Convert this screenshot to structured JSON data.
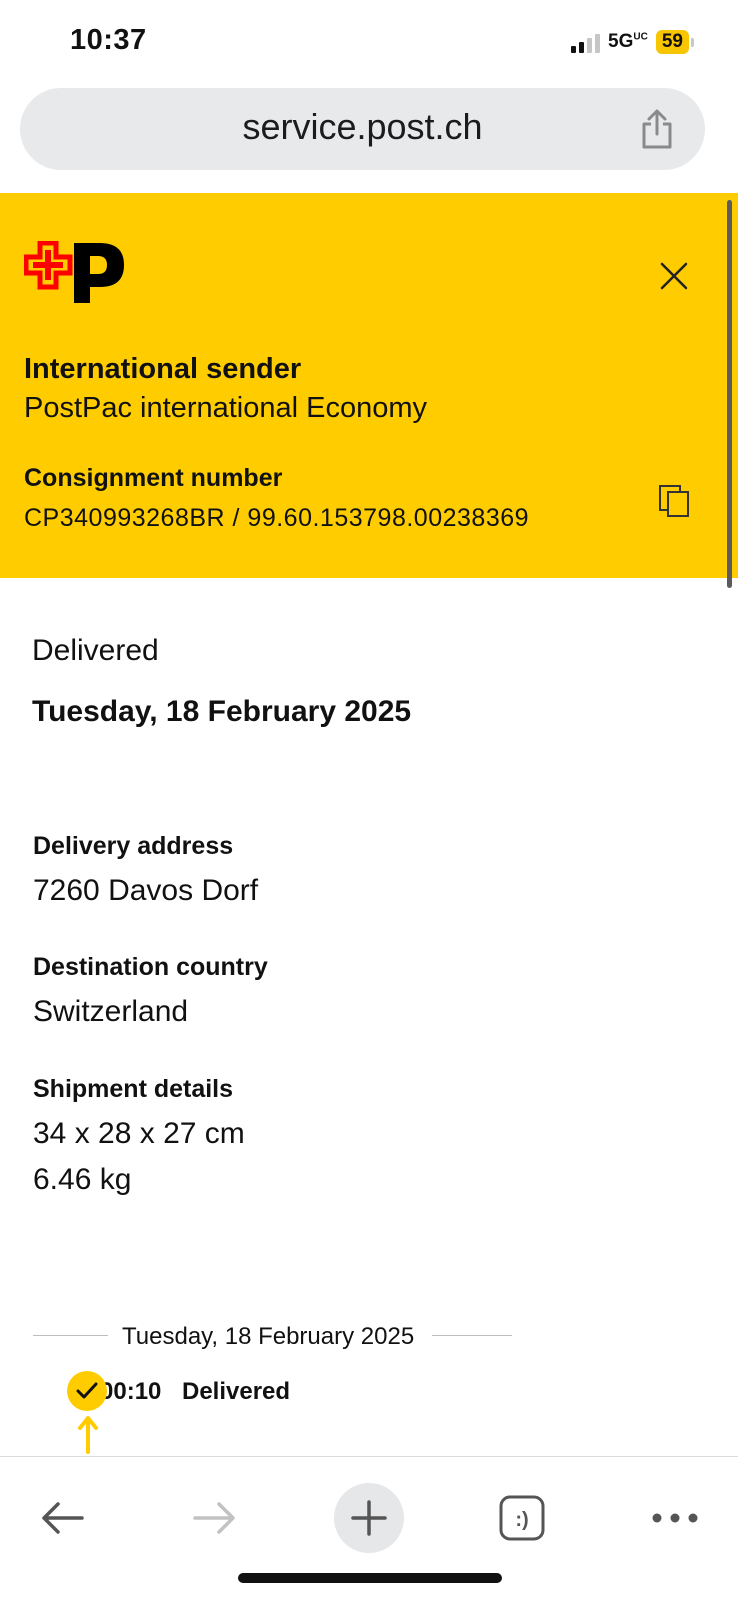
{
  "status_bar": {
    "time": "10:37",
    "network": "5G",
    "network_suffix": "UC",
    "battery": "59"
  },
  "browser": {
    "url": "service.post.ch"
  },
  "header": {
    "sender_title": "International sender",
    "sender_service": "PostPac international Economy",
    "consignment_label": "Consignment number",
    "consignment_value": "CP340993268BR /  99.60.153798.00238369"
  },
  "summary": {
    "status": "Delivered",
    "date": "Tuesday, 18 February 2025"
  },
  "details": {
    "delivery_address_label": "Delivery address",
    "delivery_address": "7260 Davos Dorf",
    "destination_label": "Destination country",
    "destination": "Switzerland",
    "shipment_label": "Shipment details",
    "dimensions": "34 x 28 x 27 cm",
    "weight": "6.46 kg"
  },
  "timeline": {
    "date": "Tuesday, 18 February 2025",
    "events": [
      {
        "time": "00:10",
        "label": "Delivered"
      }
    ]
  },
  "colors": {
    "brand_yellow": "#ffcc00",
    "logo_red": "#ff0000"
  }
}
